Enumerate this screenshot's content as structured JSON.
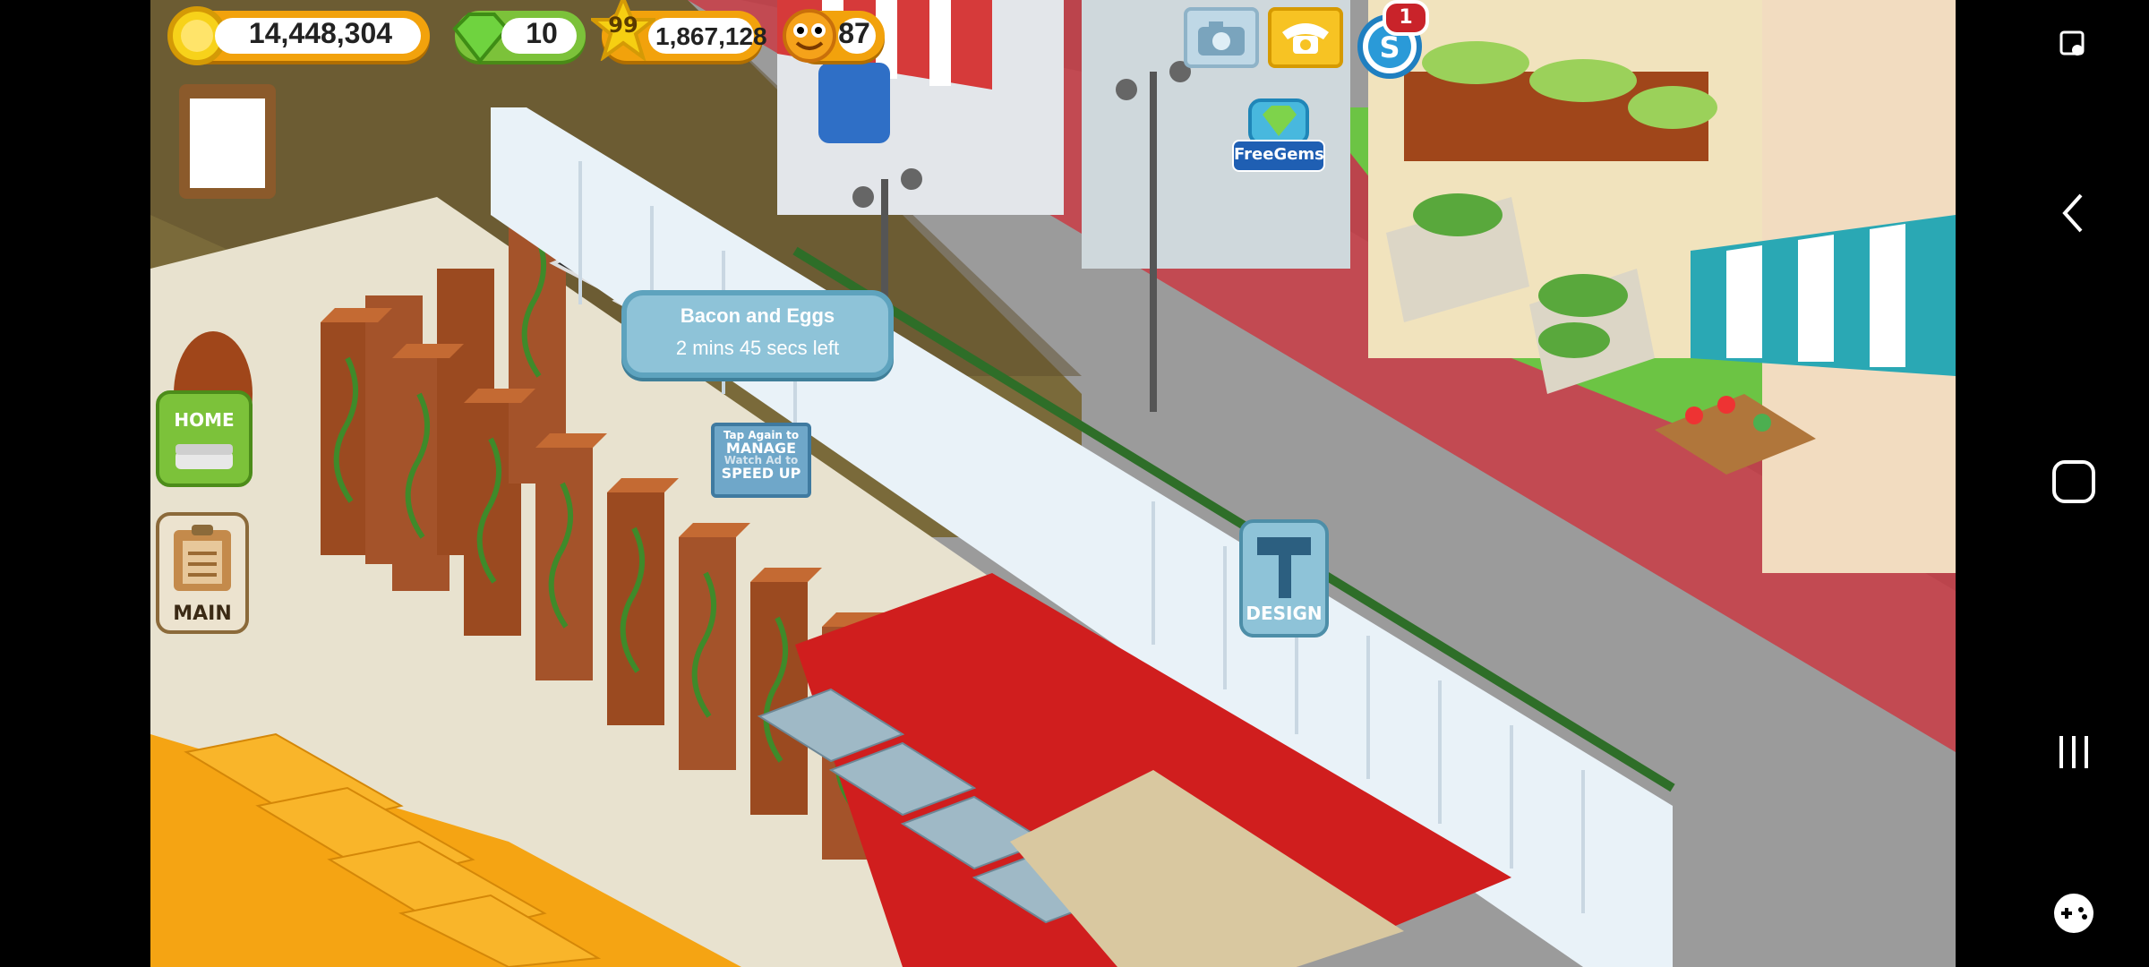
{
  "hud": {
    "coins": "14,448,304",
    "gems": "10",
    "level": "99",
    "xp": "1,867,128",
    "friends": "87",
    "notification_count": "1",
    "free_gems_label": "FreeGems"
  },
  "dish_tooltip": {
    "dish": "Bacon and Eggs",
    "time_left": "2 mins 45 secs left"
  },
  "stove_prompt": {
    "line1": "Tap Again to",
    "line2": "MANAGE",
    "line3": "Watch Ad to",
    "line4": "SPEED UP"
  },
  "buttons": {
    "home": "HOME",
    "main": "MAIN",
    "design": "DESIGN"
  },
  "colors": {
    "coin_pill": "#f2a20c",
    "gem_pill": "#7cc23a",
    "tooltip_bg": "#8ec3d8",
    "road": "#9a9a9a",
    "sidewalk": "#c0454f"
  },
  "icons": [
    "coin-icon",
    "gem-icon",
    "star-icon",
    "friend-face-icon",
    "camera-icon",
    "phone-icon",
    "social-s-icon",
    "clipboard-icon",
    "hammer-icon",
    "home-icon"
  ]
}
